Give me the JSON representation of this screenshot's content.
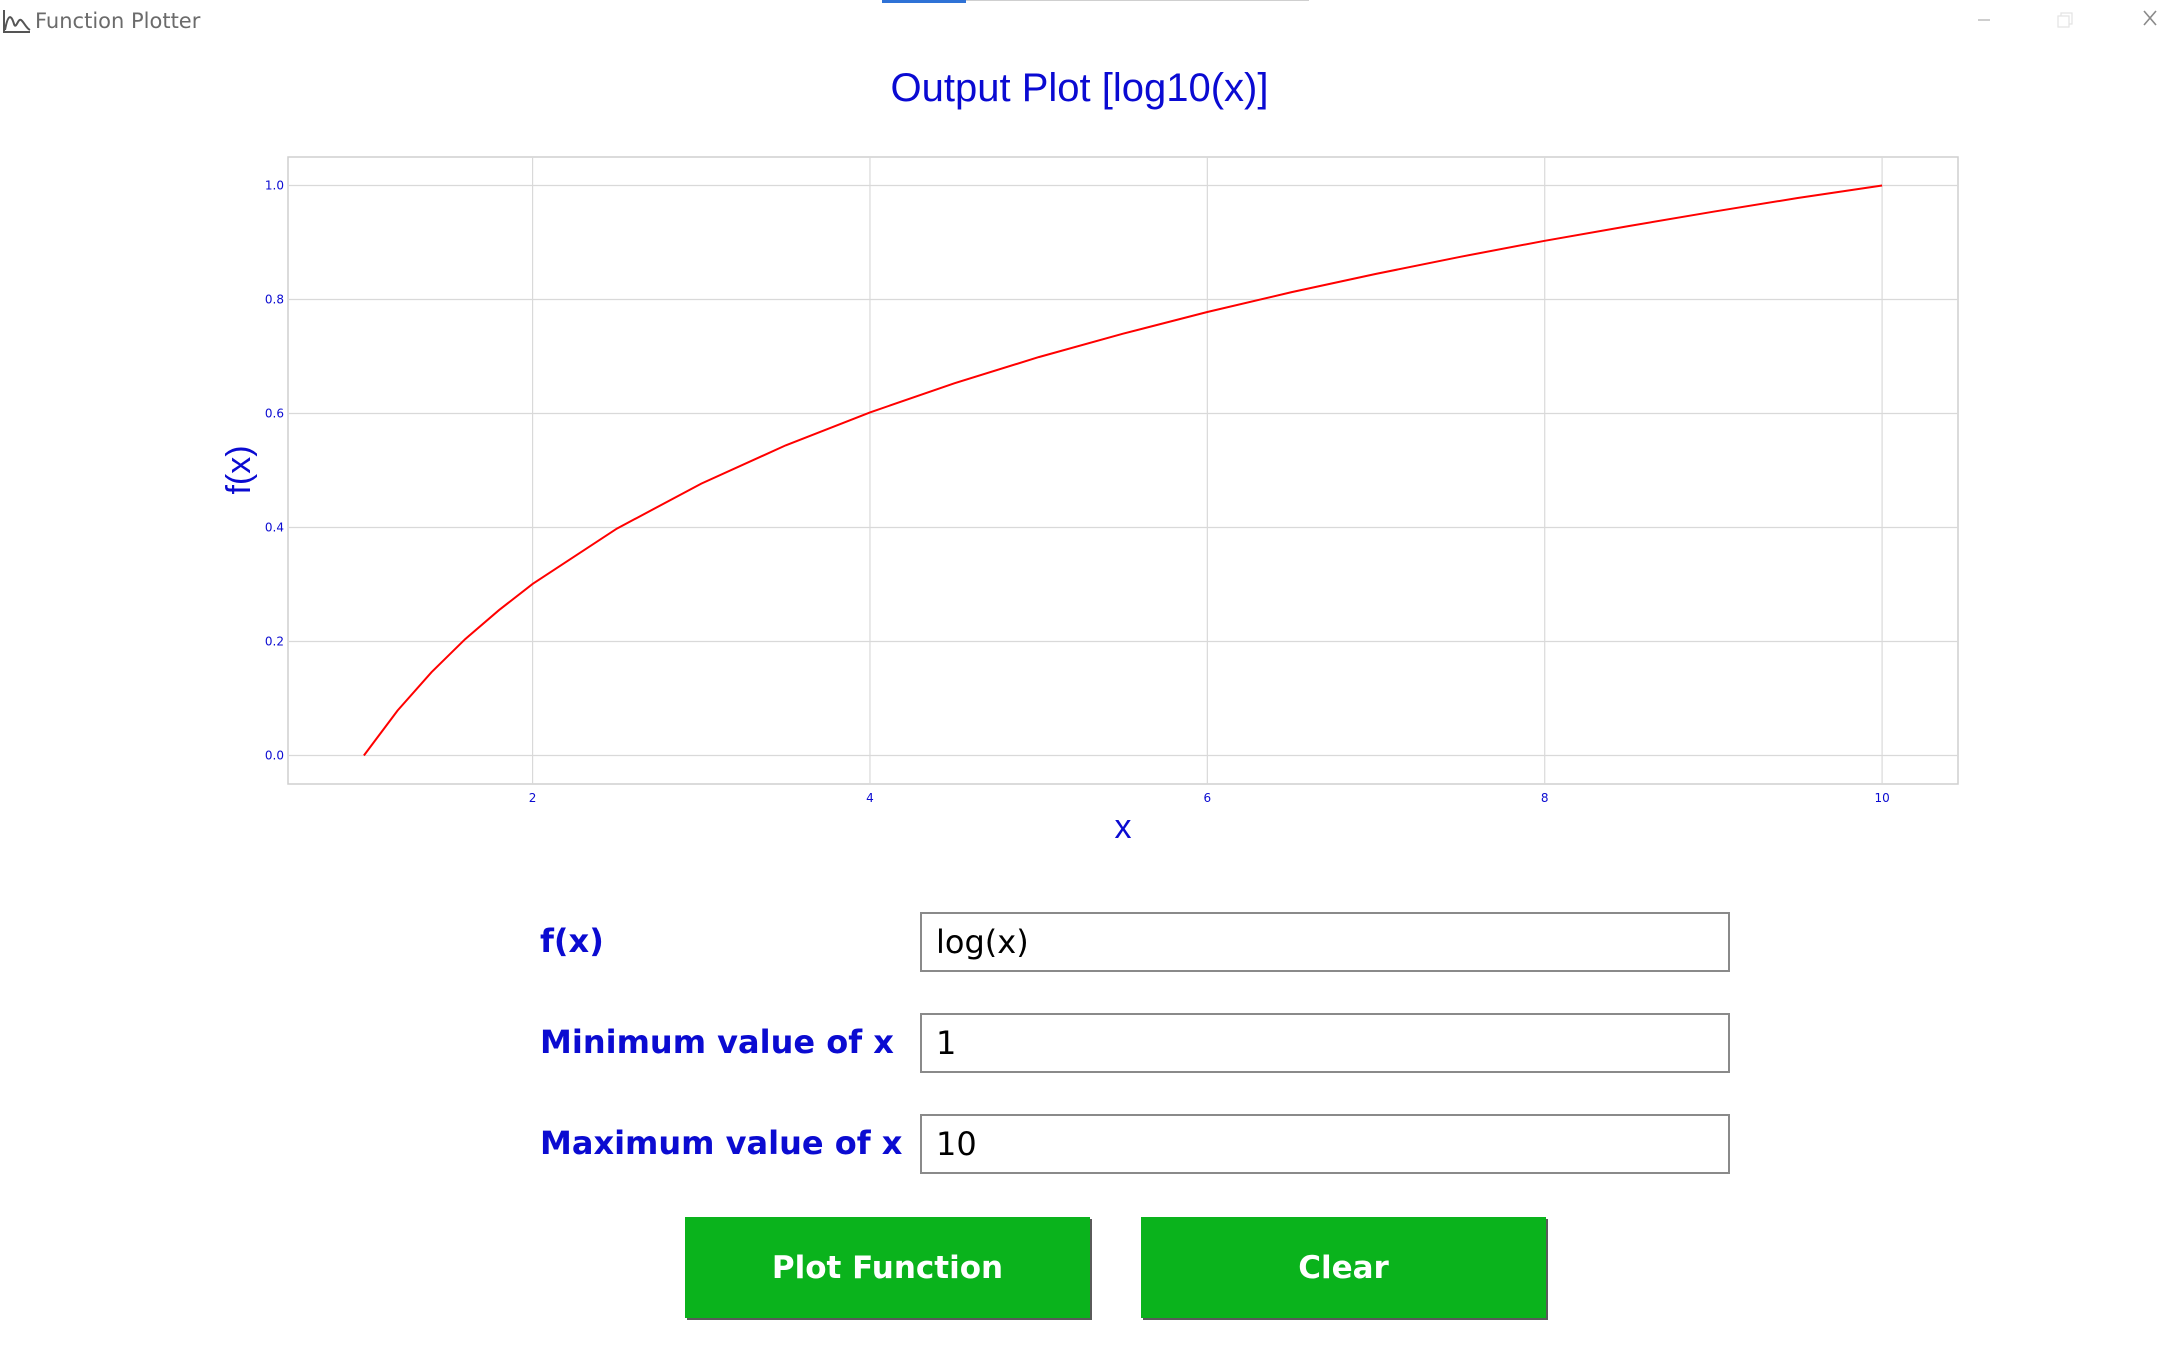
{
  "window": {
    "title": "Function Plotter",
    "icons": {
      "app": "chart-icon",
      "minimize": "minimize-icon",
      "maximize": "maximize-icon",
      "close": "close-icon"
    }
  },
  "plot": {
    "title": "Output Plot [log10(x)]"
  },
  "chart_data": {
    "type": "line",
    "title": "Output Plot [log10(x)]",
    "xlabel": "x",
    "ylabel": "f(x)",
    "xlim": [
      0.55,
      10.45
    ],
    "ylim": [
      -0.05,
      1.05
    ],
    "xticks": [
      "2",
      "4",
      "6",
      "8",
      "10"
    ],
    "yticks": [
      "0.0",
      "0.2",
      "0.4",
      "0.6",
      "0.8",
      "1.0"
    ],
    "grid": true,
    "colors": {
      "line": "#ff0000",
      "text": "#0b0bd1",
      "grid": "#d9d9d9"
    },
    "series": [
      {
        "x": [
          1,
          1.2,
          1.4,
          1.6,
          1.8,
          2,
          2.5,
          3,
          3.5,
          4,
          4.5,
          5,
          5.5,
          6,
          6.5,
          7,
          7.5,
          8,
          8.5,
          9,
          9.5,
          10
        ],
        "y": [
          0,
          0.079,
          0.146,
          0.204,
          0.255,
          0.301,
          0.398,
          0.477,
          0.544,
          0.602,
          0.653,
          0.699,
          0.74,
          0.778,
          0.813,
          0.845,
          0.875,
          0.903,
          0.929,
          0.954,
          0.978,
          1.0
        ]
      }
    ]
  },
  "form": {
    "fx_label": "f(x)",
    "fx_value": "log(x)",
    "min_label": "Minimum value of x",
    "min_value": "1",
    "max_label": "Maximum value of x",
    "max_value": "10"
  },
  "buttons": {
    "plot": "Plot Function",
    "clear": "Clear"
  },
  "colors": {
    "accent": "#0b0bd1",
    "button": "#0ab31c"
  }
}
